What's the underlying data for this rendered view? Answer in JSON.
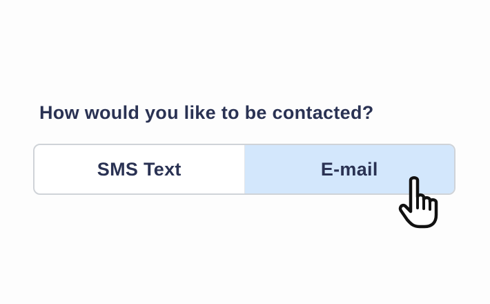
{
  "question": "How would you like to be contacted?",
  "options": [
    {
      "label": "SMS Text",
      "selected": false
    },
    {
      "label": "E-mail",
      "selected": true
    }
  ],
  "colors": {
    "text": "#2a3253",
    "selected_bg": "#d3e7fc",
    "border": "#cfd3d8"
  },
  "cursor": {
    "icon": "hand-pointer-icon"
  }
}
